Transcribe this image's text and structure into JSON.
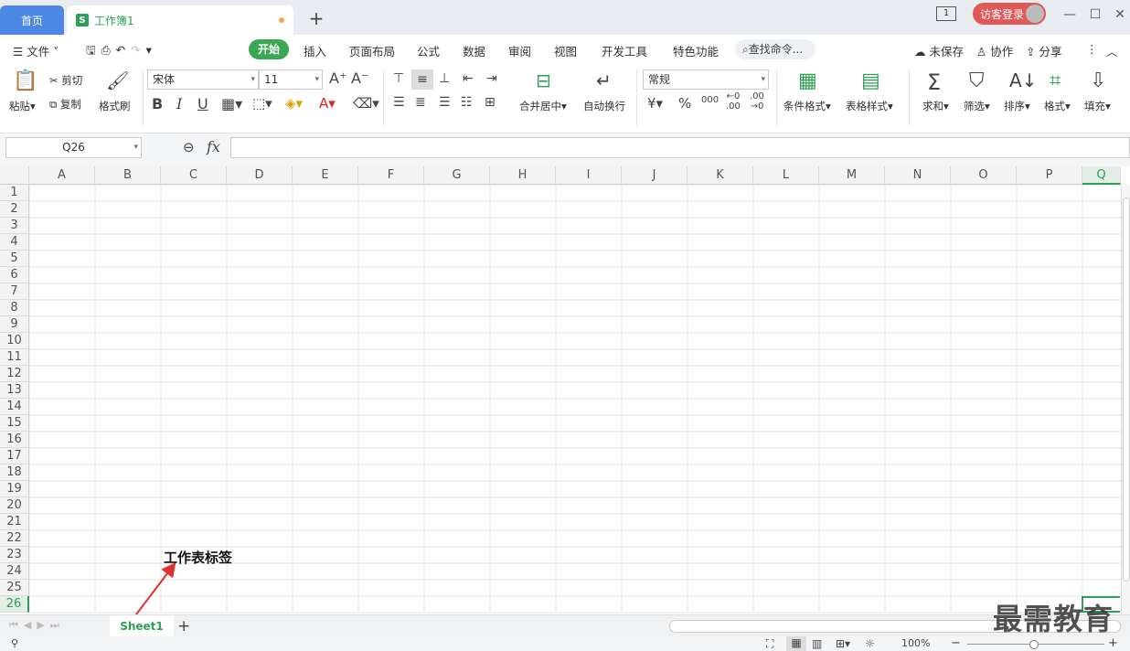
{
  "titlebar": {
    "home_tab": "首页",
    "doc_tab": "工作簿1",
    "doc_icon": "S",
    "page_indicator": "1",
    "login_label": "访客登录"
  },
  "menubar": {
    "file_label": "文件",
    "items": [
      "开始",
      "插入",
      "页面布局",
      "公式",
      "数据",
      "审阅",
      "视图",
      "开发工具",
      "特色功能"
    ],
    "search_label": "查找命令...",
    "unsaved_label": "未保存",
    "collab_label": "协作",
    "share_label": "分享"
  },
  "ribbon": {
    "paste": "粘贴",
    "cut": "剪切",
    "copy": "复制",
    "format_painter": "格式刷",
    "font_name": "宋体",
    "font_size": "11",
    "merge_center": "合并居中",
    "wrap_text": "自动换行",
    "number_format": "常规",
    "conditional_format": "条件格式",
    "table_style": "表格样式",
    "sum": "求和",
    "filter": "筛选",
    "sort": "排序",
    "format": "格式",
    "fill": "填充",
    "bold": "B",
    "italic": "I",
    "underline": "U",
    "currency": "¥",
    "percent": "%",
    "thousands": "000"
  },
  "formula_bar": {
    "cell_ref": "Q26",
    "fx": "fx"
  },
  "sheet": {
    "columns": [
      "A",
      "B",
      "C",
      "D",
      "E",
      "F",
      "G",
      "H",
      "I",
      "J",
      "K",
      "L",
      "M",
      "N",
      "O",
      "P",
      "Q"
    ],
    "rows": [
      "1",
      "2",
      "3",
      "4",
      "5",
      "6",
      "7",
      "8",
      "9",
      "10",
      "11",
      "12",
      "13",
      "14",
      "15",
      "16",
      "17",
      "18",
      "19",
      "20",
      "21",
      "22",
      "23",
      "24",
      "25",
      "26"
    ],
    "active_row": "26",
    "active_col": "Q",
    "annotation": "工作表标签"
  },
  "tabs": {
    "sheet_name": "Sheet1",
    "add_label": "+"
  },
  "status": {
    "zoom": "100%"
  },
  "watermark": "最需教育",
  "colors": {
    "accent_green": "#2e9f56",
    "home_blue": "#4e86e4",
    "login_red": "#e05858",
    "arrow_red": "#e03030"
  }
}
